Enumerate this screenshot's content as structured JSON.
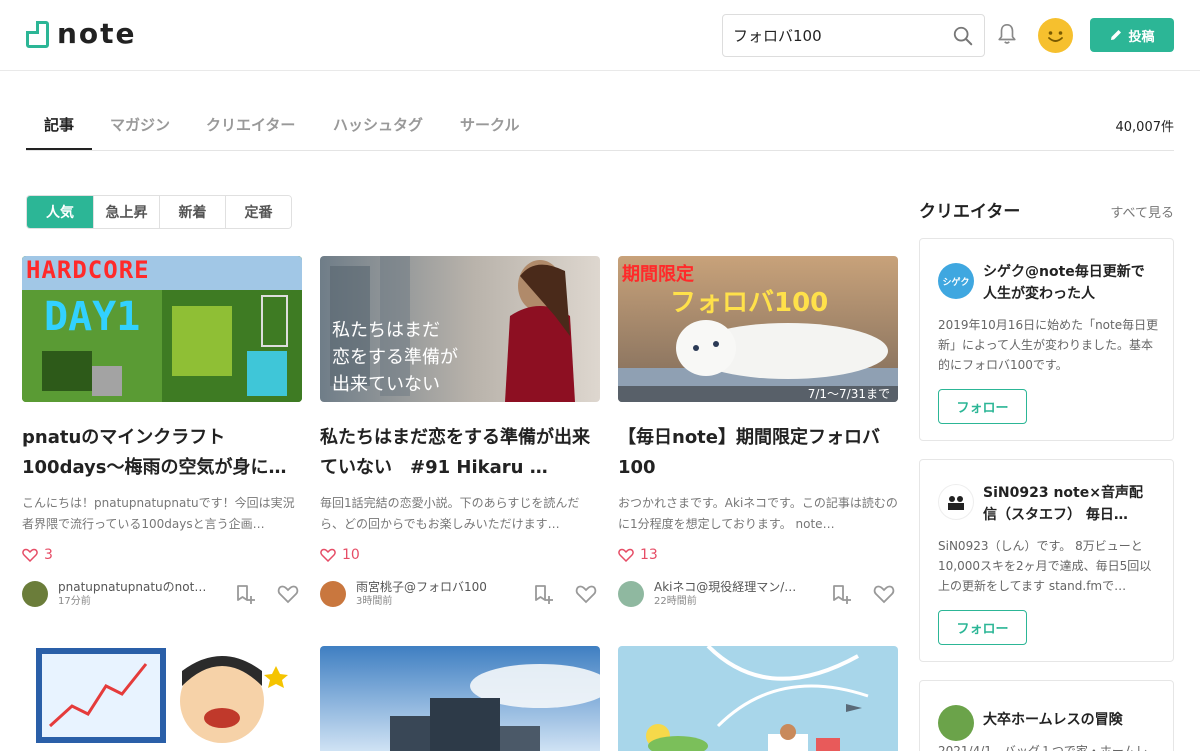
{
  "header": {
    "logo_text": "note",
    "search_value": "フォロバ100",
    "post_label": "投稿"
  },
  "tabs": [
    {
      "label": "記事",
      "active": true
    },
    {
      "label": "マガジン",
      "active": false
    },
    {
      "label": "クリエイター",
      "active": false
    },
    {
      "label": "ハッシュタグ",
      "active": false
    },
    {
      "label": "サークル",
      "active": false
    }
  ],
  "result_count": "40,007件",
  "segments": [
    {
      "label": "人気",
      "active": true
    },
    {
      "label": "急上昇",
      "active": false
    },
    {
      "label": "新着",
      "active": false
    },
    {
      "label": "定番",
      "active": false
    }
  ],
  "cards": [
    {
      "thumb_text": [
        "HARDCORE",
        "DAY1"
      ],
      "title": "pnatuのマインクラフト100days～梅雨の空気が身にしみ…",
      "excerpt": "こんにちは！pnatupnatupnatuです！今回は実況者界隈で流行っている100daysと言う企画…",
      "likes": "3",
      "author": "pnatupnatupnatuのnot…",
      "time": "17分前"
    },
    {
      "thumb_text": [
        "私たちはまだ",
        "恋をする準備が",
        "出来ていない"
      ],
      "title": "私たちはまだ恋をする準備が出来ていない　#91 Hikaru …",
      "excerpt": "毎回1話完結の恋愛小説。下のあらすじを読んだら、どの回からでもお楽しみいただけます…",
      "likes": "10",
      "author": "雨宮桃子@フォロバ100",
      "time": "3時間前"
    },
    {
      "thumb_text": [
        "期間限定",
        "フォロバ100",
        "7/1〜7/31まで"
      ],
      "title": "【毎日note】期間限定フォロバ100",
      "excerpt": "おつかれさまです。Akiネコです。この記事は読むのに1分程度を想定しております。 note…",
      "likes": "13",
      "author": "Akiネコ@現役経理マン/期…",
      "time": "22時間前"
    }
  ],
  "sidebar": {
    "title": "クリエイター",
    "see_all": "すべて見る",
    "creators": [
      {
        "avatar_text": "シゲク",
        "name": "シゲク@note毎日更新で人生が変わった人",
        "desc": "2019年10月16日に始めた「note毎日更新」によって人生が変わりました。基本的にフォロバ100です。",
        "follow": "フォロー"
      },
      {
        "avatar_text": "",
        "name": "SiN0923 note×音声配信（スタエフ） 毎日…",
        "desc": "SiN0923（しん）です。 8万ビューと10,000スキを2ヶ月で達成、毎日5回以上の更新をしてます stand.fmで…",
        "follow": "フォロー"
      },
      {
        "avatar_text": "",
        "name": "大卒ホームレスの冒険",
        "desc": "2021/4/1　バッグ１つで家・ホームレ",
        "follow": ""
      }
    ]
  },
  "colors": {
    "accent": "#2cb696",
    "like": "#e64d66"
  }
}
